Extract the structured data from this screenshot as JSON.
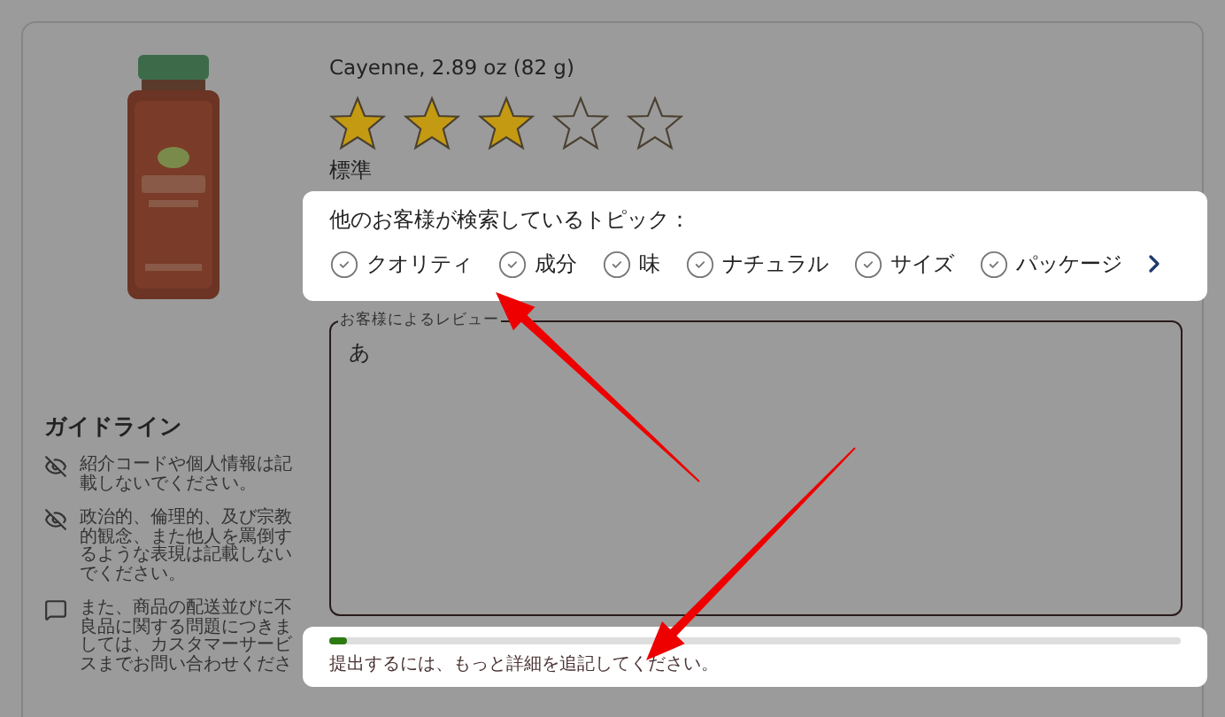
{
  "product": {
    "kind": "picture",
    "title": "Cayenne, 2.89 oz (82 g)"
  },
  "rating": {
    "stars": 3,
    "label": "標準"
  },
  "topics": {
    "heading": "他のお客様が検索しているトピック：",
    "items": [
      {
        "label": "クオリティ"
      },
      {
        "label": "成分"
      },
      {
        "label": "味"
      },
      {
        "label": "ナチュラル"
      },
      {
        "label": "サイズ"
      },
      {
        "label": "パッケージ"
      }
    ]
  },
  "review": {
    "label": "お客様によるレビュー",
    "value": "あ"
  },
  "guidelines": {
    "title": "ガイドライン",
    "items": [
      {
        "kind": "privacy",
        "text": "紹介コードや個人情報は記載しないでください。"
      },
      {
        "kind": "privacy",
        "text": "政治的、倫理的、及び宗教的観念、また他人を罵倒するような表現は記載しないでください。"
      },
      {
        "kind": "message",
        "text": "また、商品の配送並びに不良品に関する問題につきましては、カスタマーサービスまでお問い合わせくださ"
      }
    ]
  },
  "progress": {
    "level": 0.02,
    "message": "提出するには、もっと詳細を追記してください。"
  }
}
